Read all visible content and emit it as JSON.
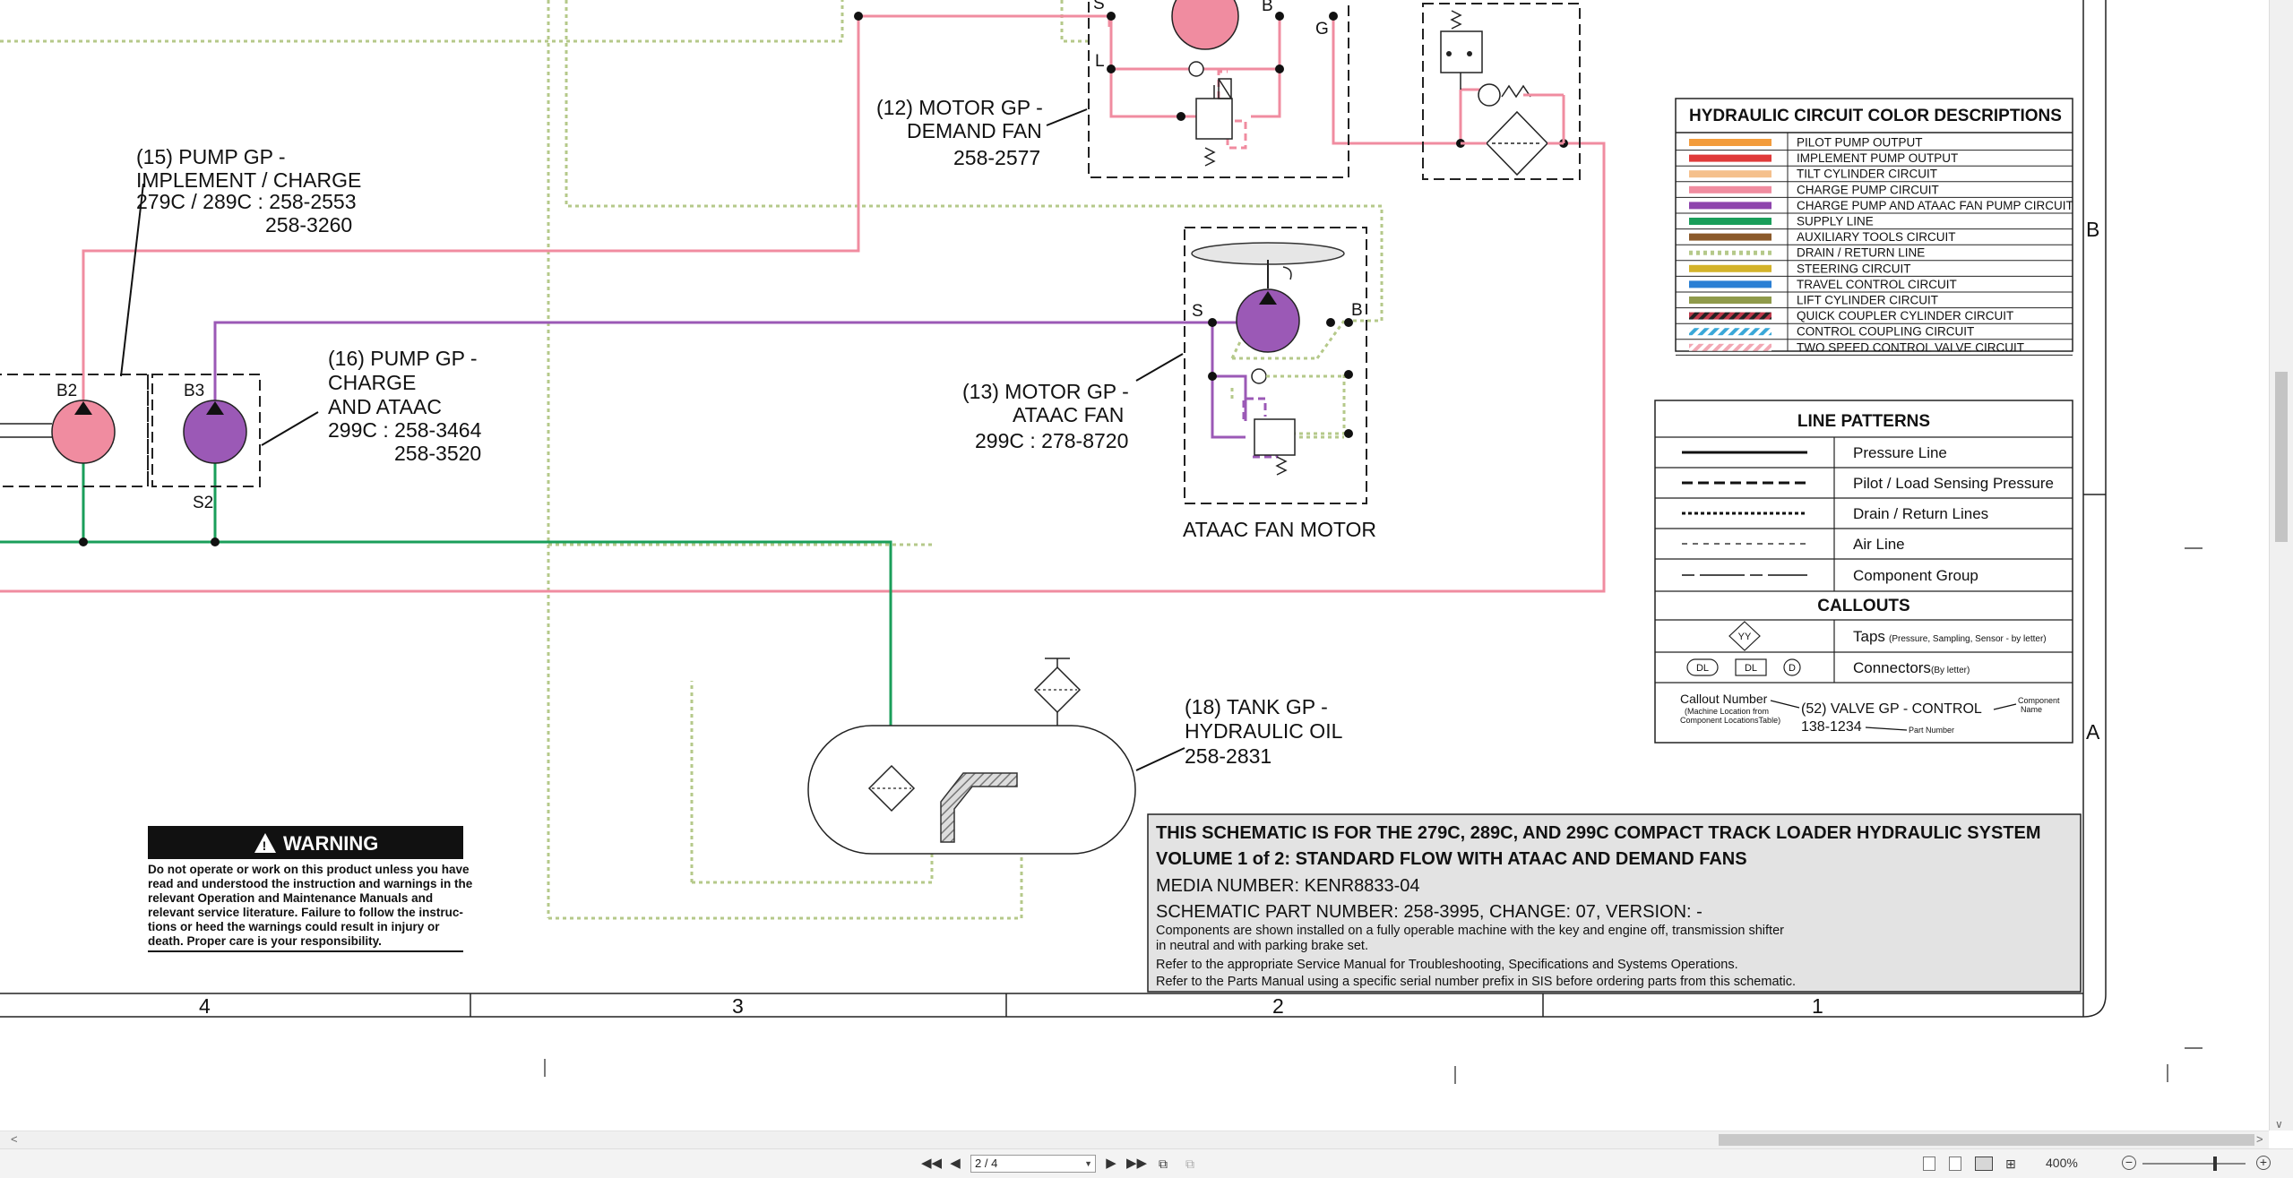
{
  "pump15": {
    "l1": "(15) PUMP GP -",
    "l2": "IMPLEMENT / CHARGE",
    "l3": "279C / 289C : 258-2553",
    "l4": "258-3260"
  },
  "pump16": {
    "l1": "(16) PUMP GP -",
    "l2": "CHARGE",
    "l3": "AND ATAAC",
    "l4": "299C : 258-3464",
    "l5": "258-3520"
  },
  "motor12": {
    "l1": "(12) MOTOR GP -",
    "l2": "DEMAND FAN",
    "l3": "258-2577"
  },
  "motor13": {
    "l1": "(13) MOTOR GP -",
    "l2": "ATAAC FAN",
    "l3": "299C : 278-8720"
  },
  "tank18": {
    "l1": "(18) TANK GP -",
    "l2": "HYDRAULIC OIL",
    "l3": "258-2831"
  },
  "ataac_label": "ATAAC FAN MOTOR",
  "ports": {
    "b2": "B2",
    "b3": "B3",
    "s2": "S2",
    "s12": "S",
    "b12": "B",
    "l12": "L",
    "g12": "G",
    "s13": "S",
    "b13": "B"
  },
  "colors": {
    "charge": "#f08ca0",
    "charge_ataac": "#9b59b6",
    "supply": "#1a9e5a",
    "drain": "#b5c98a"
  },
  "color_desc": {
    "title": "HYDRAULIC CIRCUIT COLOR DESCRIPTIONS",
    "items": [
      {
        "label": "PILOT PUMP OUTPUT",
        "color": "#f39c3c"
      },
      {
        "label": "IMPLEMENT PUMP OUTPUT",
        "color": "#e03a3a"
      },
      {
        "label": "TILT CYLINDER CIRCUIT",
        "color": "#f5c08c"
      },
      {
        "label": "CHARGE PUMP CIRCUIT",
        "color": "#f08ca0"
      },
      {
        "label": "CHARGE PUMP AND ATAAC FAN PUMP CIRCUIT",
        "color": "#8e44ad"
      },
      {
        "label": "SUPPLY LINE",
        "color": "#1a9e5a"
      },
      {
        "label": "AUXILIARY TOOLS CIRCUIT",
        "color": "#8b5a2b"
      },
      {
        "label": "DRAIN / RETURN LINE",
        "color": "#b5c98a"
      },
      {
        "label": "STEERING CIRCUIT",
        "color": "#d4b32a"
      },
      {
        "label": "TRAVEL CONTROL CIRCUIT",
        "color": "#2a7fd4"
      },
      {
        "label": "LIFT CYLINDER CIRCUIT",
        "color": "#8f9a4a"
      },
      {
        "label": "QUICK COUPLER CYLINDER CIRCUIT",
        "color": "#c0394b"
      },
      {
        "label": "CONTROL COUPLING CIRCUIT",
        "color": "#3aa8d8"
      },
      {
        "label": "TWO SPEED CONTROL VALVE CIRCUIT",
        "color": "#f2a8b4"
      }
    ]
  },
  "line_patterns": {
    "title": "LINE PATTERNS",
    "items": [
      "Pressure Line",
      "Pilot / Load Sensing Pressure",
      "Drain / Return Lines",
      "Air Line",
      "Component Group"
    ]
  },
  "callouts": {
    "title": "CALLOUTS",
    "taps_symbol": "YY",
    "taps": "Taps",
    "taps_note": "(Pressure, Sampling, Sensor - by letter)",
    "conn_a": "DL",
    "conn_b": "DL",
    "conn_c": "D",
    "connectors": "Connectors",
    "connectors_note": "(By letter)",
    "callout_number": "Callout Number",
    "callout_note1": "(Machine Location from",
    "callout_note2": "Component LocationsTable)",
    "valve": "(52) VALVE GP - CONTROL",
    "part": "138-1234",
    "part_label": "Part Number",
    "comp_name1": "Component",
    "comp_name2": "Name"
  },
  "warning": {
    "title": "WARNING",
    "lines": [
      "Do not operate or work on this product unless you have",
      "read and understood the instruction and warnings in the",
      "relevant Operation and Maintenance Manuals and",
      "relevant service literature. Failure to follow the instruc-",
      "tions or heed the warnings could result in injury or",
      "death. Proper care is your responsibility."
    ]
  },
  "title_block": {
    "l1": "THIS SCHEMATIC IS FOR THE 279C, 289C, AND 299C COMPACT TRACK LOADER HYDRAULIC SYSTEM",
    "l2": "VOLUME 1 of 2: STANDARD FLOW WITH ATAAC AND DEMAND FANS",
    "l3": "MEDIA NUMBER: KENR8833-04",
    "l4": "SCHEMATIC PART NUMBER: 258-3995, CHANGE: 07, VERSION: -",
    "n1": "Components are shown installed on a fully operable machine with the key and engine off, transmission shifter",
    "n2": "in neutral and with parking brake set.",
    "n3": "Refer to the appropriate Service Manual for Troubleshooting, Specifications and Systems Operations.",
    "n4": "Refer to the Parts Manual using a specific serial number prefix in SIS before ordering parts from this schematic."
  },
  "zones": {
    "c4": "4",
    "c3": "3",
    "c2": "2",
    "c1": "1",
    "rb": "B",
    "ra": "A"
  },
  "toolbar": {
    "page": "2 / 4",
    "zoom": "400%"
  }
}
